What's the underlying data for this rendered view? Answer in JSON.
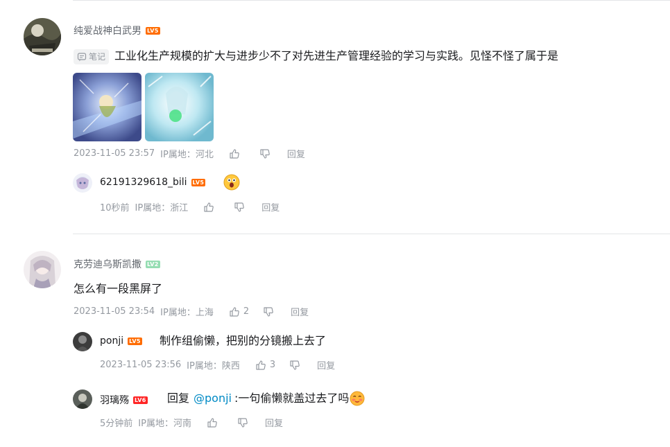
{
  "comments": [
    {
      "user": "纯爱战神白武男",
      "level": "LV5",
      "note_tag": "笔记",
      "text": "工业化生产规模的扩大与进步少不了对先进生产管理经验的学习与实践。见怪不怪了属于是",
      "time": "2023-11-05 23:57",
      "ip": "IP属地：河北",
      "reply_label": "回复",
      "replies": [
        {
          "user": "62191329618_bili",
          "level": "LV5",
          "time": "10秒前",
          "ip": "IP属地：浙江",
          "reply_label": "回复"
        }
      ]
    },
    {
      "user": "克劳迪乌斯凯撒",
      "level": "LV2",
      "text": "怎么有一段黑屏了",
      "time": "2023-11-05 23:54",
      "ip": "IP属地：上海",
      "likes": "2",
      "reply_label": "回复",
      "replies": [
        {
          "user": "ponji",
          "level": "LV5",
          "text": "制作组偷懒，把别的分镜搬上去了",
          "time": "2023-11-05 23:56",
          "ip": "IP属地：陕西",
          "likes": "3",
          "reply_label": "回复"
        },
        {
          "user": "羽璃殇",
          "level": "LV6",
          "reply_prefix": "回复",
          "mention": "@ponji",
          "text": ":一句偷懒就盖过去了吗",
          "time": "5分钟前",
          "ip": "IP属地：河南",
          "reply_label": "回复"
        }
      ]
    }
  ]
}
